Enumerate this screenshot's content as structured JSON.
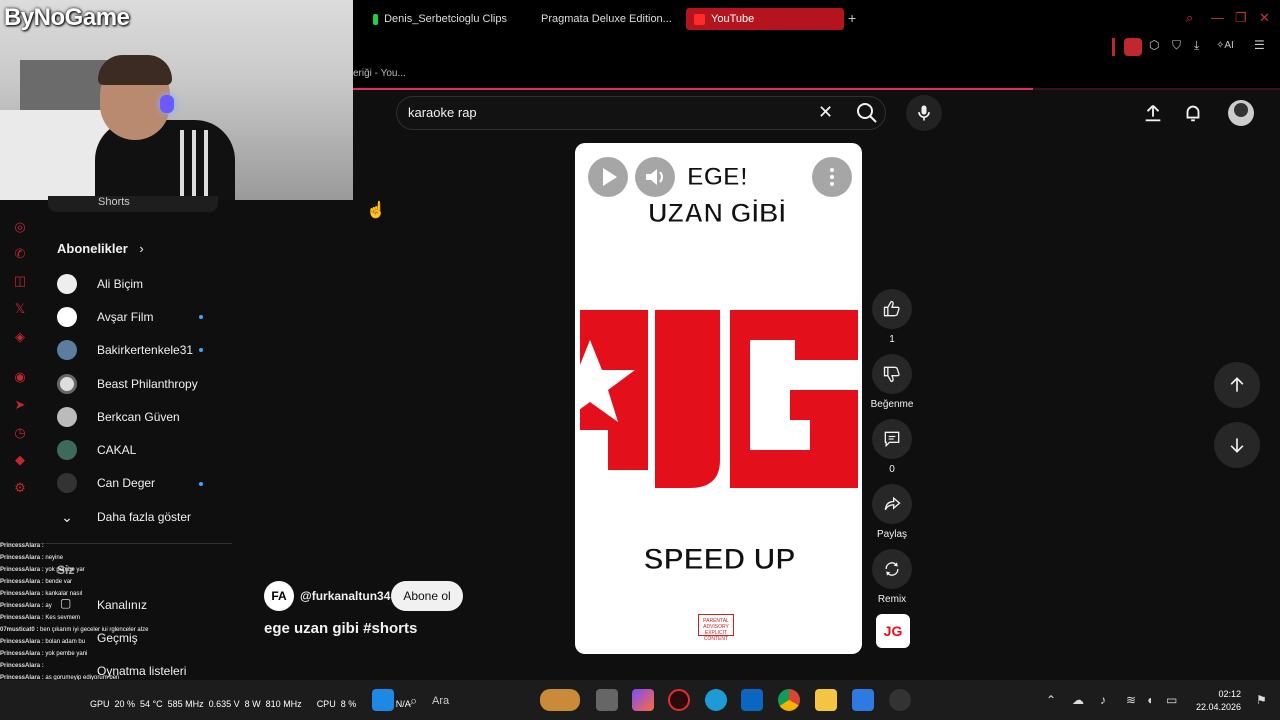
{
  "browser": {
    "tabs": [
      {
        "label": "Denis_Serbetcioglu Clips",
        "color": "#19d24b"
      },
      {
        "label": "Pragmata Deluxe Edition...",
        "color": "#8aa0c0"
      },
      {
        "label": "YouTube",
        "color": "#ff2a2a"
      }
    ],
    "new_tab": "+",
    "url_fragment": "eriği - You...",
    "ai_label": "AI"
  },
  "overlay": {
    "brand": "ByNoGame"
  },
  "sidebar": {
    "shorts_label": "Shorts",
    "subscriptions_header": "Abonelikler",
    "subscriptions": [
      {
        "name": "Ali Biçim",
        "live_dot": false
      },
      {
        "name": "Avşar Film",
        "live_dot": true
      },
      {
        "name": "Bakirkertenkele31",
        "live_dot": true
      },
      {
        "name": "Beast Philanthropy",
        "live_dot": false
      },
      {
        "name": "Berkcan Güven",
        "live_dot": false
      },
      {
        "name": "CAKAL",
        "live_dot": false
      },
      {
        "name": "Can Deger",
        "live_dot": true
      }
    ],
    "show_more": "Daha fazla göster",
    "you_header": "Siz",
    "you_items": [
      "Kanalınız",
      "Geçmiş",
      "Oynatma listeleri"
    ]
  },
  "chat": [
    {
      "user": "PrincessAlara",
      "msg": ""
    },
    {
      "user": "PrincessAlara",
      "msg": "neyine"
    },
    {
      "user": "PrincessAlara",
      "msg": "yok pembe yar"
    },
    {
      "user": "PrincessAlara",
      "msg": "bende var"
    },
    {
      "user": "PrincessAlara",
      "msg": "kankalar nasıl"
    },
    {
      "user": "PrincessAlara",
      "msg": "ay"
    },
    {
      "user": "PrincessAlara",
      "msg": "Kes sevmem"
    },
    {
      "user": "07musticat0",
      "msg": "ben çıkarım iyi geceler iui rglenceler alze"
    },
    {
      "user": "PrincessAlara",
      "msg": "bolan adam bu"
    },
    {
      "user": "PrincessAlara",
      "msg": "yok pembe yani"
    },
    {
      "user": "PrincessAlara",
      "msg": ""
    },
    {
      "user": "PrincessAlara",
      "msg": "as gorumeyip ediyorum ben"
    },
    {
      "user": "PrincessAlara",
      "msg": "aynı"
    },
    {
      "user": "PrincessAlara",
      "msg": ""
    },
    {
      "user": "daddyebro",
      "msg": "sal"
    }
  ],
  "search": {
    "query": "karaoke rap"
  },
  "video": {
    "top_line": "EGE!",
    "second_line": "UZAN GİBİ",
    "logo_text": "JG",
    "bottom_line": "SPEED UP",
    "advisory": "PARENTAL ADVISORY EXPLICIT CONTENT"
  },
  "actions": {
    "like_count": "1",
    "dislike_label": "Beğenme",
    "comment_count": "0",
    "share_label": "Paylaş",
    "remix_label": "Remix",
    "thumb_text": "JG"
  },
  "channel": {
    "logo_text": "FA",
    "handle": "@furkanaltun34",
    "subscribe_label": "Abone ol",
    "title": "ege uzan gibi #shorts"
  },
  "taskbar": {
    "stats": "GPU  20 %  54 °C  585 MHz  0.635 V  8 W  810 MHz      CPU  8 %       N/A   N/A",
    "search_label": "Ara",
    "time": "02:12",
    "date": "22.04.2026"
  },
  "colors": {
    "accent": "#c0282d",
    "yt_red": "#ff0000",
    "jg_red": "#e3101c",
    "progress": "#e0306b"
  }
}
